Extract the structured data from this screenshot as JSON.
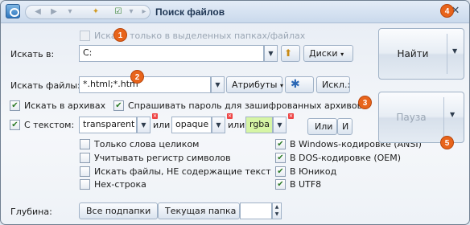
{
  "window": {
    "title": "Поиск файлов",
    "close_symbol": "✕"
  },
  "search_in_selected": {
    "label": "Искать только в выделенных папках/файлах",
    "checked": false
  },
  "search_in": {
    "label": "Искать в:",
    "value": "C:",
    "disks_button": "Диски"
  },
  "search_files": {
    "label": "Искать файлы:",
    "value": "*.html;*.htm",
    "attributes_button": "Атрибуты",
    "exclude_button": "Искл.:"
  },
  "archives": {
    "label": "Искать в архивах",
    "checked": true
  },
  "ask_password": {
    "label": "Спрашивать пароль для зашифрованных архивов",
    "checked": true
  },
  "with_text": {
    "label": "С текстом:",
    "checked": true,
    "term1": "transparent",
    "or1": "или",
    "term2": "opaque",
    "or2": "или",
    "term3": "rgba",
    "or_button": "Или",
    "and_button": "И"
  },
  "options_left": [
    {
      "label": "Только слова целиком",
      "checked": false
    },
    {
      "label": "Учитывать регистр символов",
      "checked": false
    },
    {
      "label": "Искать файлы, НЕ содержащие текст",
      "checked": false
    },
    {
      "label": "Hex-строка",
      "checked": false
    }
  ],
  "options_right": [
    {
      "label": "В Windows-кодировке (ANSI)",
      "checked": true
    },
    {
      "label": "В DOS-кодировке (OEM)",
      "checked": true
    },
    {
      "label": "В Юникод",
      "checked": true
    },
    {
      "label": "В UTF8",
      "checked": true
    }
  ],
  "depth": {
    "label": "Глубина:",
    "all_button": "Все подпапки",
    "current_button": "Текущая папка"
  },
  "find_button": "Найти",
  "pause_button": "Пауза",
  "badges": [
    "1",
    "2",
    "3",
    "4",
    "5"
  ],
  "check_mark": "✔"
}
